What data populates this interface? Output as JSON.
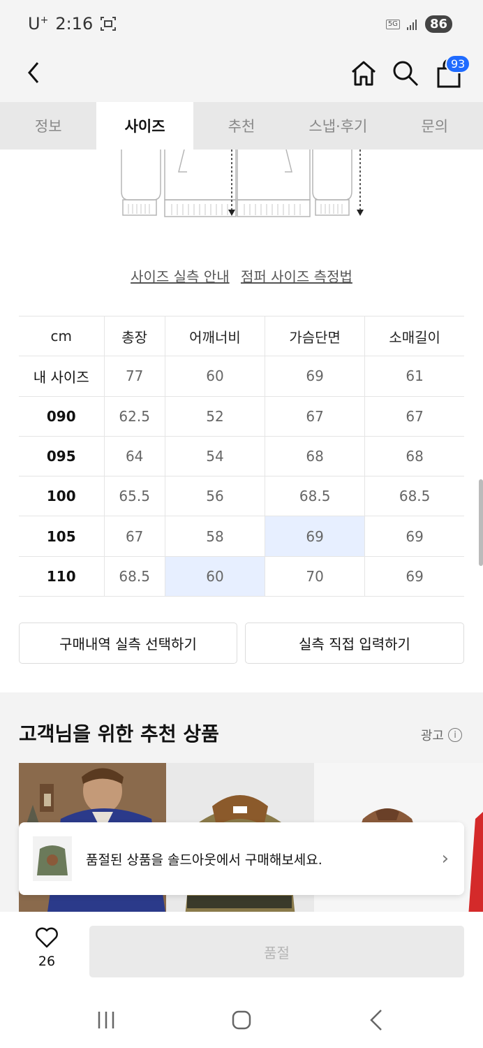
{
  "status": {
    "carrier": "U",
    "carrier_sup": "+",
    "time": "2:16",
    "network": "5G",
    "battery": "86"
  },
  "header": {
    "cart_count": "93"
  },
  "tabs": [
    {
      "label": "정보"
    },
    {
      "label": "사이즈"
    },
    {
      "label": "추천"
    },
    {
      "label": "스냅·후기"
    },
    {
      "label": "문의"
    }
  ],
  "links": {
    "size_guide": "사이즈 실측 안내",
    "measure_method": "점퍼 사이즈 측정법"
  },
  "size_table": {
    "headers": [
      "cm",
      "총장",
      "어깨너비",
      "가슴단면",
      "소매길이"
    ],
    "rows": [
      [
        "내 사이즈",
        "77",
        "60",
        "69",
        "61"
      ],
      [
        "090",
        "62.5",
        "52",
        "67",
        "67"
      ],
      [
        "095",
        "64",
        "54",
        "68",
        "68"
      ],
      [
        "100",
        "65.5",
        "56",
        "68.5",
        "68.5"
      ],
      [
        "105",
        "67",
        "58",
        "69",
        "69"
      ],
      [
        "110",
        "68.5",
        "60",
        "70",
        "69"
      ]
    ],
    "highlight_color": "#e7efff"
  },
  "actions": {
    "purchase_history": "구매내역 실측 선택하기",
    "direct_input": "실측 직접 입력하기"
  },
  "recommend": {
    "title": "고객님을 위한 추천 상품",
    "ad_label": "광고",
    "info_glyph": "i"
  },
  "toast": {
    "message": "품절된 상품을 솔드아웃에서 구매해보세요.",
    "chevron": "›"
  },
  "bottom": {
    "like_count": "26",
    "soldout_label": "품절"
  },
  "colors": {
    "accent": "#1f6bff",
    "tab_bg": "#e8e8e8"
  }
}
